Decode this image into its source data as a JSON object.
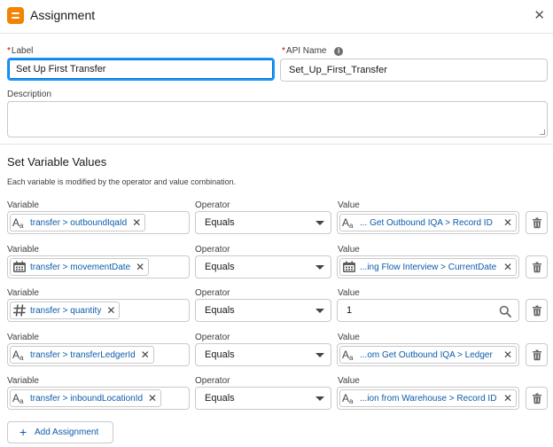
{
  "header": {
    "title": "Assignment",
    "icon": "assignment-icon",
    "close_icon": "close-icon",
    "close_glyph": "✕",
    "icon_color": "#f38303"
  },
  "label": {
    "label": "Label",
    "required_mark": "*",
    "value": "Set Up First Transfer"
  },
  "api_name": {
    "label": "API Name",
    "required_mark": "*",
    "value": "Set_Up_First_Transfer",
    "info_icon": "info-icon"
  },
  "description": {
    "label": "Description",
    "value": ""
  },
  "section": {
    "title": "Set Variable Values",
    "description": "Each variable is modified by the operator and value combination."
  },
  "column_labels": {
    "variable": "Variable",
    "operator": "Operator",
    "value": "Value"
  },
  "rows": [
    {
      "variable": "transfer > outboundIqaId",
      "variable_icon": "text-type-icon",
      "operator": "Equals",
      "value": "... Get Outbound IQA > Record ID",
      "value_icon": "text-type-icon",
      "value_is_pill": true
    },
    {
      "variable": "transfer > movementDate",
      "variable_icon": "calendar-icon",
      "operator": "Equals",
      "value": "...ing Flow Interview > CurrentDate",
      "value_icon": "calendar-icon",
      "value_is_pill": true
    },
    {
      "variable": "transfer > quantity",
      "variable_icon": "number-type-icon",
      "operator": "Equals",
      "value": "1",
      "value_icon": "search-icon",
      "value_is_pill": false
    },
    {
      "variable": "transfer > transferLedgerId",
      "variable_icon": "text-type-icon",
      "operator": "Equals",
      "value": "...om Get Outbound IQA > Ledger",
      "value_icon": "text-type-icon",
      "value_is_pill": true
    },
    {
      "variable": "transfer > inboundLocationId",
      "variable_icon": "text-type-icon",
      "operator": "Equals",
      "value": "...ion from Warehouse > Record ID",
      "value_icon": "text-type-icon",
      "value_is_pill": true
    }
  ],
  "remove_glyph": "✕",
  "add_button": {
    "label": "Add Assignment",
    "icon": "plus-icon",
    "glyph": "+"
  }
}
